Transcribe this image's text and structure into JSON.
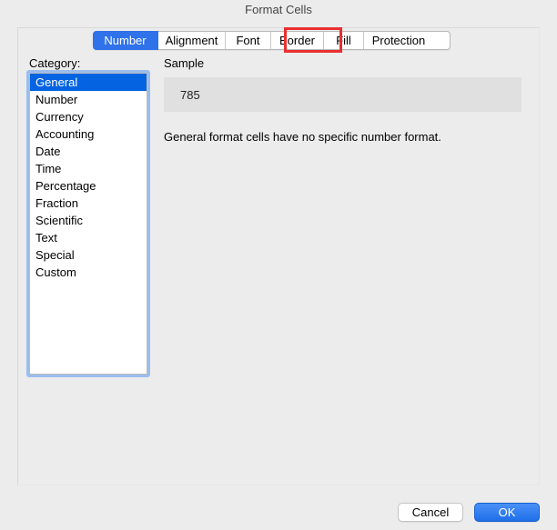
{
  "window": {
    "title": "Format Cells"
  },
  "tabs": {
    "number": "Number",
    "alignment": "Alignment",
    "font": "Font",
    "border": "Border",
    "fill": "Fill",
    "protection": "Protection"
  },
  "categoryLabel": "Category:",
  "categories": {
    "general": "General",
    "number": "Number",
    "currency": "Currency",
    "accounting": "Accounting",
    "date": "Date",
    "time": "Time",
    "percentage": "Percentage",
    "fraction": "Fraction",
    "scientific": "Scientific",
    "text": "Text",
    "special": "Special",
    "custom": "Custom"
  },
  "sampleLabel": "Sample",
  "sampleValue": "785",
  "description": "General format cells have no specific number format.",
  "buttons": {
    "cancel": "Cancel",
    "ok": "OK"
  }
}
